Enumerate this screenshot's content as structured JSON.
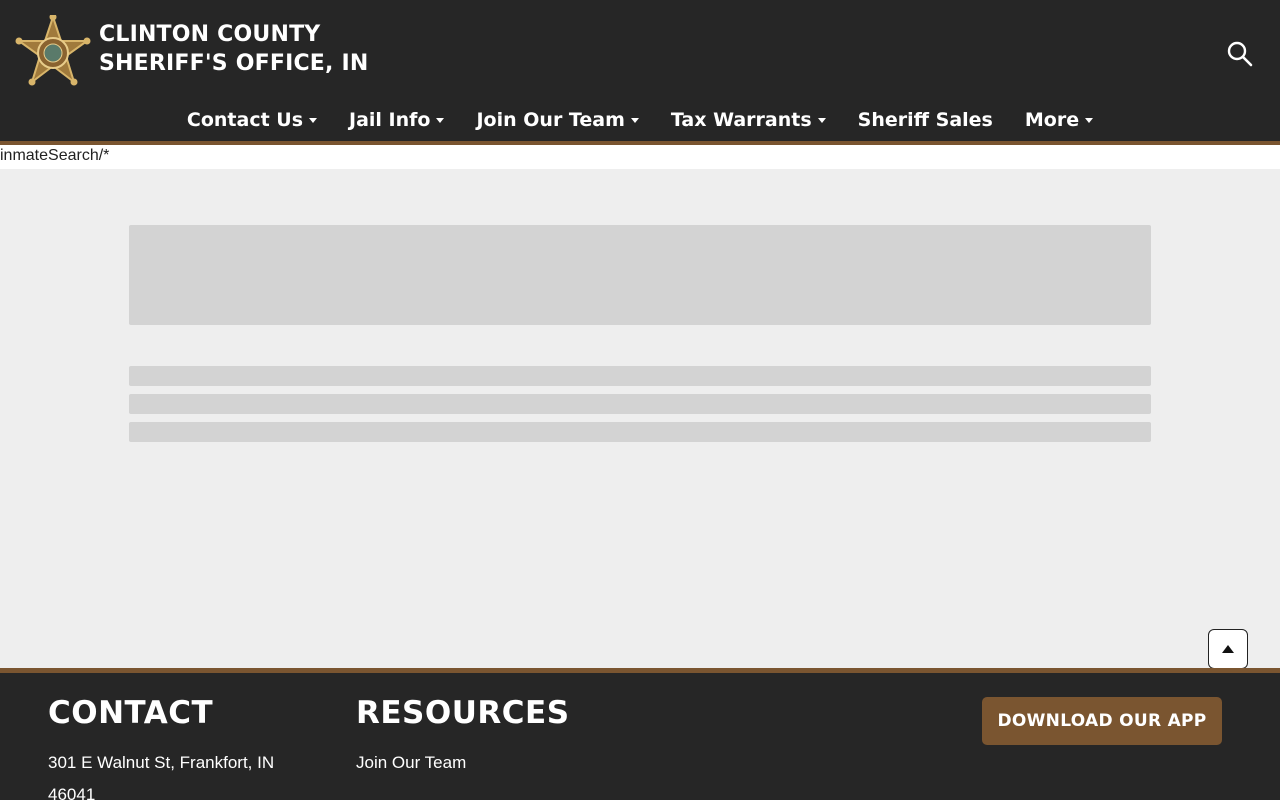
{
  "header": {
    "title_line1": "CLINTON COUNTY",
    "title_line2": "SHERIFF'S OFFICE, IN",
    "badge_icon": "sheriff-star-badge-icon",
    "search_icon": "search-icon"
  },
  "nav": {
    "items": [
      {
        "label": "Contact Us",
        "has_dropdown": true
      },
      {
        "label": "Jail Info",
        "has_dropdown": true
      },
      {
        "label": "Join Our Team",
        "has_dropdown": true
      },
      {
        "label": "Tax Warrants",
        "has_dropdown": true
      },
      {
        "label": "Sheriff Sales",
        "has_dropdown": false
      },
      {
        "label": "More",
        "has_dropdown": true
      }
    ]
  },
  "path_text": "inmateSearch/*",
  "footer": {
    "contact_title": "CONTACT",
    "address_line1": "301 E Walnut St, Frankfort, IN",
    "address_line2": "46041",
    "resources_title": "RESOURCES",
    "resource_link": "Join Our Team",
    "app_button": "DOWNLOAD OUR APP"
  },
  "colors": {
    "header_bg": "#262626",
    "accent_brown": "#7a5530",
    "page_bg": "#eeeeee",
    "skeleton": "#d3d3d3"
  }
}
